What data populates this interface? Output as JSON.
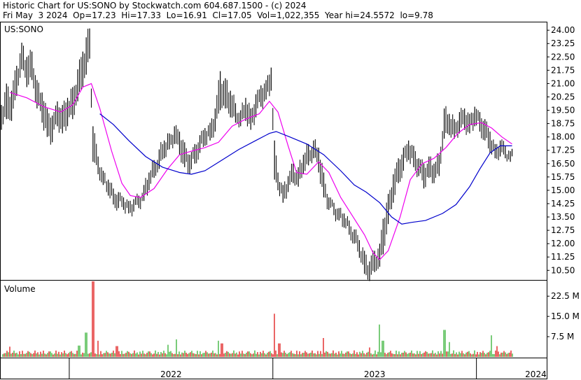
{
  "header": {
    "line1": "Historic Chart for US:SONO by Stockwatch.com 604.687.1500 - (c) 2024",
    "line2": "Fri May  3 2024  Op=17.23  Hi=17.33  Lo=16.91  Cl=17.05  Vol=1,022,355  Year hi=24.5572  lo=9.78"
  },
  "colors": {
    "up_volume": "#22aa22",
    "down_volume": "#dd0000",
    "ma_short": "#ee00ee",
    "ma_long": "#0000cc",
    "price_bar": "#000000"
  },
  "chart_data": [
    {
      "type": "line",
      "panel": "price",
      "title": "US:SONO",
      "y_ticks": [
        "24.00",
        "23.25",
        "22.50",
        "21.75",
        "21.00",
        "20.25",
        "19.50",
        "18.75",
        "18.00",
        "17.25",
        "16.50",
        "15.75",
        "15.00",
        "14.25",
        "13.50",
        "12.75",
        "12.00",
        "11.25",
        "10.50"
      ],
      "ylim": [
        10.0,
        24.4
      ],
      "x_labels": [
        "2022",
        "2023",
        "2024"
      ],
      "x_label_months": [
        6,
        18,
        27.5
      ],
      "year_boundaries_months": [
        0,
        12,
        24
      ],
      "xlim_months": [
        -4,
        28.1
      ],
      "bars": [
        {
          "t": -4.0,
          "high": 19.8,
          "low": 18.4
        },
        {
          "t": -3.7,
          "high": 21.0,
          "low": 19.0
        },
        {
          "t": -3.4,
          "high": 20.6,
          "low": 18.9
        },
        {
          "t": -3.1,
          "high": 22.0,
          "low": 20.3
        },
        {
          "t": -2.8,
          "high": 23.3,
          "low": 21.8
        },
        {
          "t": -2.5,
          "high": 22.5,
          "low": 20.8
        },
        {
          "t": -2.2,
          "high": 22.8,
          "low": 21.2
        },
        {
          "t": -1.9,
          "high": 21.2,
          "low": 19.6
        },
        {
          "t": -1.6,
          "high": 20.5,
          "low": 18.8
        },
        {
          "t": -1.3,
          "high": 19.6,
          "low": 18.0
        },
        {
          "t": -1.0,
          "high": 19.2,
          "low": 17.7
        },
        {
          "t": -0.7,
          "high": 20.0,
          "low": 18.6
        },
        {
          "t": -0.4,
          "high": 19.8,
          "low": 18.2
        },
        {
          "t": -0.1,
          "high": 20.2,
          "low": 18.6
        },
        {
          "t": 0.2,
          "high": 20.8,
          "low": 19.0
        },
        {
          "t": 0.5,
          "high": 21.8,
          "low": 20.0
        },
        {
          "t": 0.8,
          "high": 22.8,
          "low": 20.8
        },
        {
          "t": 1.0,
          "high": 23.6,
          "low": 21.5
        },
        {
          "t": 1.2,
          "high": 24.1,
          "low": 22.4
        },
        {
          "t": 1.4,
          "high": 18.6,
          "low": 16.6
        },
        {
          "t": 1.7,
          "high": 16.9,
          "low": 15.9
        },
        {
          "t": 2.0,
          "high": 16.1,
          "low": 15.3
        },
        {
          "t": 2.3,
          "high": 15.6,
          "low": 14.7
        },
        {
          "t": 2.6,
          "high": 15.1,
          "low": 14.2
        },
        {
          "t": 2.9,
          "high": 14.9,
          "low": 14.0
        },
        {
          "t": 3.2,
          "high": 14.6,
          "low": 13.9
        },
        {
          "t": 3.5,
          "high": 14.4,
          "low": 13.7
        },
        {
          "t": 3.8,
          "high": 14.5,
          "low": 13.8
        },
        {
          "t": 4.1,
          "high": 14.7,
          "low": 14.0
        },
        {
          "t": 4.4,
          "high": 15.3,
          "low": 14.4
        },
        {
          "t": 4.7,
          "high": 16.0,
          "low": 15.0
        },
        {
          "t": 5.0,
          "high": 16.7,
          "low": 15.7
        },
        {
          "t": 5.3,
          "high": 17.3,
          "low": 16.2
        },
        {
          "t": 5.6,
          "high": 17.8,
          "low": 16.8
        },
        {
          "t": 5.9,
          "high": 18.2,
          "low": 17.3
        },
        {
          "t": 6.2,
          "high": 18.6,
          "low": 17.6
        },
        {
          "t": 6.5,
          "high": 18.3,
          "low": 17.0
        },
        {
          "t": 6.8,
          "high": 17.7,
          "low": 16.3
        },
        {
          "t": 7.1,
          "high": 17.0,
          "low": 15.9
        },
        {
          "t": 7.4,
          "high": 17.6,
          "low": 16.5
        },
        {
          "t": 7.7,
          "high": 18.1,
          "low": 17.1
        },
        {
          "t": 8.0,
          "high": 18.5,
          "low": 17.5
        },
        {
          "t": 8.3,
          "high": 18.8,
          "low": 17.8
        },
        {
          "t": 8.6,
          "high": 19.6,
          "low": 18.3
        },
        {
          "t": 8.9,
          "high": 21.7,
          "low": 19.5
        },
        {
          "t": 9.2,
          "high": 21.3,
          "low": 19.6
        },
        {
          "t": 9.5,
          "high": 20.6,
          "low": 19.1
        },
        {
          "t": 9.8,
          "high": 19.9,
          "low": 18.8
        },
        {
          "t": 10.1,
          "high": 19.5,
          "low": 18.6
        },
        {
          "t": 10.4,
          "high": 20.2,
          "low": 18.9
        },
        {
          "t": 10.7,
          "high": 19.6,
          "low": 18.4
        },
        {
          "t": 11.0,
          "high": 20.4,
          "low": 19.1
        },
        {
          "t": 11.3,
          "high": 20.9,
          "low": 19.7
        },
        {
          "t": 11.6,
          "high": 21.2,
          "low": 20.1
        },
        {
          "t": 11.9,
          "high": 21.9,
          "low": 20.6
        },
        {
          "t": 12.1,
          "high": 17.8,
          "low": 15.6
        },
        {
          "t": 12.3,
          "high": 16.0,
          "low": 15.0
        },
        {
          "t": 12.6,
          "high": 15.3,
          "low": 14.3
        },
        {
          "t": 12.9,
          "high": 15.8,
          "low": 14.9
        },
        {
          "t": 13.2,
          "high": 16.5,
          "low": 15.4
        },
        {
          "t": 13.5,
          "high": 16.3,
          "low": 15.2
        },
        {
          "t": 13.8,
          "high": 17.0,
          "low": 15.9
        },
        {
          "t": 14.1,
          "high": 17.6,
          "low": 16.4
        },
        {
          "t": 14.4,
          "high": 17.8,
          "low": 16.8
        },
        {
          "t": 14.7,
          "high": 17.4,
          "low": 16.0
        },
        {
          "t": 15.0,
          "high": 16.0,
          "low": 14.6
        },
        {
          "t": 15.3,
          "high": 14.6,
          "low": 13.9
        },
        {
          "t": 15.6,
          "high": 14.3,
          "low": 13.6
        },
        {
          "t": 15.9,
          "high": 14.0,
          "low": 13.3
        },
        {
          "t": 16.2,
          "high": 13.7,
          "low": 12.9
        },
        {
          "t": 16.5,
          "high": 13.3,
          "low": 12.5
        },
        {
          "t": 16.8,
          "high": 12.8,
          "low": 12.0
        },
        {
          "t": 17.1,
          "high": 12.2,
          "low": 11.2
        },
        {
          "t": 17.4,
          "high": 11.6,
          "low": 10.3
        },
        {
          "t": 17.7,
          "high": 11.0,
          "low": 9.9
        },
        {
          "t": 18.0,
          "high": 11.6,
          "low": 10.4
        },
        {
          "t": 18.3,
          "high": 12.0,
          "low": 10.7
        },
        {
          "t": 18.5,
          "high": 13.4,
          "low": 11.4
        },
        {
          "t": 18.8,
          "high": 14.8,
          "low": 13.1
        },
        {
          "t": 19.1,
          "high": 15.9,
          "low": 14.3
        },
        {
          "t": 19.4,
          "high": 16.8,
          "low": 15.4
        },
        {
          "t": 19.7,
          "high": 17.4,
          "low": 16.1
        },
        {
          "t": 20.0,
          "high": 17.8,
          "low": 16.7
        },
        {
          "t": 20.3,
          "high": 17.5,
          "low": 16.3
        },
        {
          "t": 20.6,
          "high": 16.8,
          "low": 15.8
        },
        {
          "t": 20.9,
          "high": 16.5,
          "low": 15.1
        },
        {
          "t": 21.2,
          "high": 16.9,
          "low": 15.7
        },
        {
          "t": 21.5,
          "high": 16.5,
          "low": 15.4
        },
        {
          "t": 21.8,
          "high": 17.0,
          "low": 15.8
        },
        {
          "t": 22.1,
          "high": 19.6,
          "low": 17.9
        },
        {
          "t": 22.4,
          "high": 19.3,
          "low": 18.1
        },
        {
          "t": 22.7,
          "high": 19.0,
          "low": 17.9
        },
        {
          "t": 23.0,
          "high": 19.4,
          "low": 18.2
        },
        {
          "t": 23.3,
          "high": 19.6,
          "low": 18.4
        },
        {
          "t": 23.6,
          "high": 19.3,
          "low": 18.2
        },
        {
          "t": 23.9,
          "high": 19.7,
          "low": 18.6
        },
        {
          "t": 24.2,
          "high": 19.4,
          "low": 18.3
        },
        {
          "t": 24.5,
          "high": 19.0,
          "low": 17.8
        },
        {
          "t": 24.8,
          "high": 18.3,
          "low": 17.1
        },
        {
          "t": 25.1,
          "high": 17.6,
          "low": 16.8
        },
        {
          "t": 25.4,
          "high": 17.8,
          "low": 16.9
        },
        {
          "t": 25.7,
          "high": 17.5,
          "low": 16.8
        },
        {
          "t": 26.0,
          "high": 17.2,
          "low": 16.6
        },
        {
          "t": 26.1,
          "high": 17.33,
          "low": 16.91
        }
      ],
      "ma_short": [
        [
          -3.5,
          20.5
        ],
        [
          -2.5,
          20.2
        ],
        [
          -1.5,
          19.7
        ],
        [
          -0.5,
          19.4
        ],
        [
          0.2,
          19.8
        ],
        [
          0.8,
          20.8
        ],
        [
          1.3,
          21.0
        ],
        [
          1.8,
          19.6
        ],
        [
          2.5,
          17.2
        ],
        [
          3.1,
          15.4
        ],
        [
          3.6,
          14.7
        ],
        [
          4.2,
          14.6
        ],
        [
          5.0,
          15.1
        ],
        [
          5.8,
          16.2
        ],
        [
          6.5,
          17.0
        ],
        [
          7.2,
          17.2
        ],
        [
          8.0,
          17.4
        ],
        [
          8.8,
          17.7
        ],
        [
          9.6,
          18.6
        ],
        [
          10.4,
          19.0
        ],
        [
          11.2,
          19.3
        ],
        [
          11.8,
          20.0
        ],
        [
          12.3,
          19.4
        ],
        [
          12.9,
          17.5
        ],
        [
          13.4,
          16.0
        ],
        [
          14.0,
          15.9
        ],
        [
          14.7,
          16.6
        ],
        [
          15.3,
          16.0
        ],
        [
          16.0,
          14.6
        ],
        [
          16.8,
          13.4
        ],
        [
          17.4,
          12.5
        ],
        [
          17.9,
          11.5
        ],
        [
          18.3,
          11.1
        ],
        [
          18.8,
          11.6
        ],
        [
          19.5,
          13.5
        ],
        [
          20.1,
          15.6
        ],
        [
          20.8,
          16.5
        ],
        [
          21.5,
          16.8
        ],
        [
          22.2,
          17.4
        ],
        [
          22.9,
          18.2
        ],
        [
          23.6,
          18.7
        ],
        [
          24.3,
          18.8
        ],
        [
          24.9,
          18.5
        ],
        [
          25.5,
          18.0
        ],
        [
          26.1,
          17.6
        ]
      ],
      "ma_long": [
        [
          1.8,
          19.3
        ],
        [
          2.6,
          18.7
        ],
        [
          3.5,
          17.8
        ],
        [
          4.5,
          16.9
        ],
        [
          5.5,
          16.3
        ],
        [
          6.5,
          16.0
        ],
        [
          7.2,
          15.9
        ],
        [
          8.0,
          16.1
        ],
        [
          9.0,
          16.7
        ],
        [
          10.0,
          17.3
        ],
        [
          11.0,
          17.8
        ],
        [
          11.8,
          18.2
        ],
        [
          12.2,
          18.3
        ],
        [
          13.0,
          18.0
        ],
        [
          14.0,
          17.6
        ],
        [
          15.0,
          17.0
        ],
        [
          16.0,
          16.1
        ],
        [
          16.8,
          15.3
        ],
        [
          17.5,
          14.9
        ],
        [
          18.3,
          14.3
        ],
        [
          19.0,
          13.5
        ],
        [
          19.6,
          13.1
        ],
        [
          20.2,
          13.2
        ],
        [
          21.0,
          13.3
        ],
        [
          22.0,
          13.7
        ],
        [
          22.8,
          14.2
        ],
        [
          23.6,
          15.2
        ],
        [
          24.2,
          16.2
        ],
        [
          24.8,
          17.1
        ],
        [
          25.4,
          17.5
        ],
        [
          26.1,
          17.5
        ]
      ]
    },
    {
      "type": "bar",
      "panel": "volume",
      "title": "Volume",
      "y_ticks": [
        "22.5 M",
        "15.0 M",
        "7.5 M"
      ],
      "ylim": [
        0,
        28
      ],
      "spikes": [
        {
          "t": -4.0,
          "value": 4.5,
          "dir": "up"
        },
        {
          "t": -3.5,
          "value": 3.8,
          "dir": "down"
        },
        {
          "t": 0.6,
          "value": 4.2,
          "dir": "up"
        },
        {
          "t": 1.0,
          "value": 9.0,
          "dir": "up"
        },
        {
          "t": 1.4,
          "value": 28.0,
          "dir": "down"
        },
        {
          "t": 1.7,
          "value": 6.0,
          "dir": "down"
        },
        {
          "t": 2.8,
          "value": 4.0,
          "dir": "down"
        },
        {
          "t": 5.8,
          "value": 4.5,
          "dir": "up"
        },
        {
          "t": 6.3,
          "value": 6.5,
          "dir": "up"
        },
        {
          "t": 8.8,
          "value": 6.0,
          "dir": "up"
        },
        {
          "t": 9.0,
          "value": 5.0,
          "dir": "down"
        },
        {
          "t": 12.1,
          "value": 16.0,
          "dir": "down"
        },
        {
          "t": 12.4,
          "value": 5.0,
          "dir": "down"
        },
        {
          "t": 15.0,
          "value": 7.0,
          "dir": "down"
        },
        {
          "t": 17.7,
          "value": 3.5,
          "dir": "down"
        },
        {
          "t": 18.3,
          "value": 12.0,
          "dir": "up"
        },
        {
          "t": 18.5,
          "value": 6.0,
          "dir": "up"
        },
        {
          "t": 22.1,
          "value": 10.0,
          "dir": "up"
        },
        {
          "t": 22.4,
          "value": 5.5,
          "dir": "up"
        },
        {
          "t": 24.9,
          "value": 8.0,
          "dir": "up"
        },
        {
          "t": 25.2,
          "value": 4.0,
          "dir": "down"
        }
      ]
    }
  ]
}
